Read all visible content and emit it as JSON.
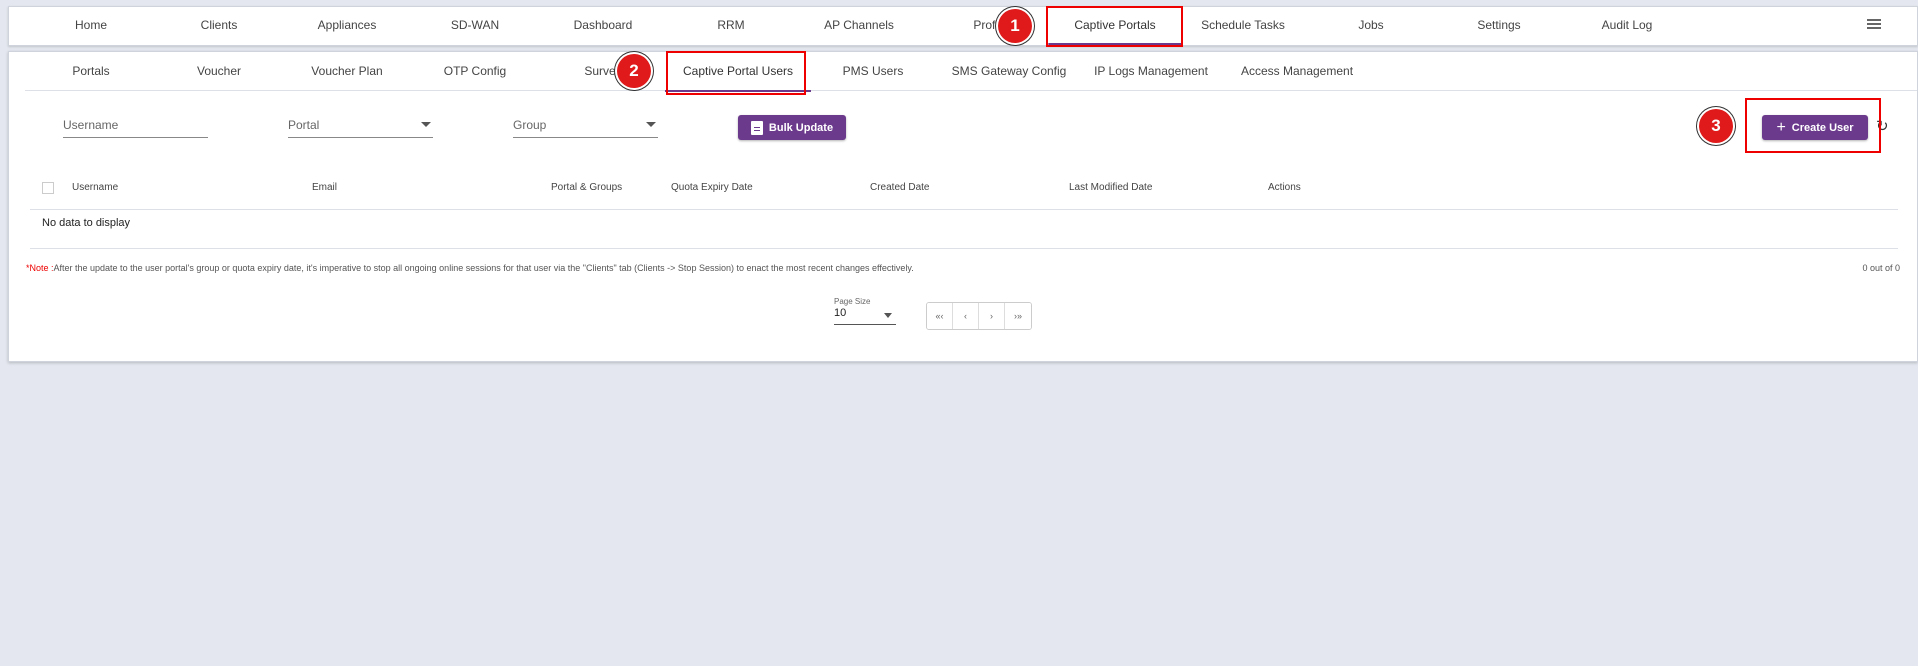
{
  "top_nav": {
    "items": [
      "Home",
      "Clients",
      "Appliances",
      "SD-WAN",
      "Dashboard",
      "RRM",
      "AP Channels",
      "Profil",
      "Captive Portals",
      "Schedule Tasks",
      "Jobs",
      "Settings",
      "Audit Log"
    ],
    "active": "Captive Portals"
  },
  "sub_nav": {
    "items": [
      "Portals",
      "Voucher",
      "Voucher Plan",
      "OTP Config",
      "Survey",
      "Captive Portal Users",
      "PMS Users",
      "SMS Gateway Config",
      "IP Logs Management",
      "Access Management"
    ],
    "active": "Captive Portal Users"
  },
  "filters": {
    "username_placeholder": "Username",
    "portal_placeholder": "Portal",
    "group_placeholder": "Group"
  },
  "buttons": {
    "bulk_update": "Bulk Update",
    "create_user": "Create User",
    "create_user_icon": "+"
  },
  "table": {
    "columns": [
      "Username",
      "Email",
      "Portal & Groups",
      "Quota Expiry Date",
      "Created Date",
      "Last Modified Date",
      "Actions"
    ],
    "empty_text": "No data to display"
  },
  "note": {
    "prefix": "*Note :",
    "text": "After the update to the user portal's group or quota expiry date, it's imperative to stop all ongoing online sessions for that user via the \"Clients\" tab (Clients -> Stop Session) to enact the most recent changes effectively."
  },
  "pagination": {
    "count_text": "0 out of 0",
    "page_size_label": "Page Size",
    "page_size": "10",
    "controls": [
      "«‹",
      "‹",
      "›",
      "›»"
    ]
  },
  "annotations": [
    "1",
    "2",
    "3"
  ],
  "colors": {
    "accent": "#6b3a8c",
    "highlight": "#e00000"
  }
}
